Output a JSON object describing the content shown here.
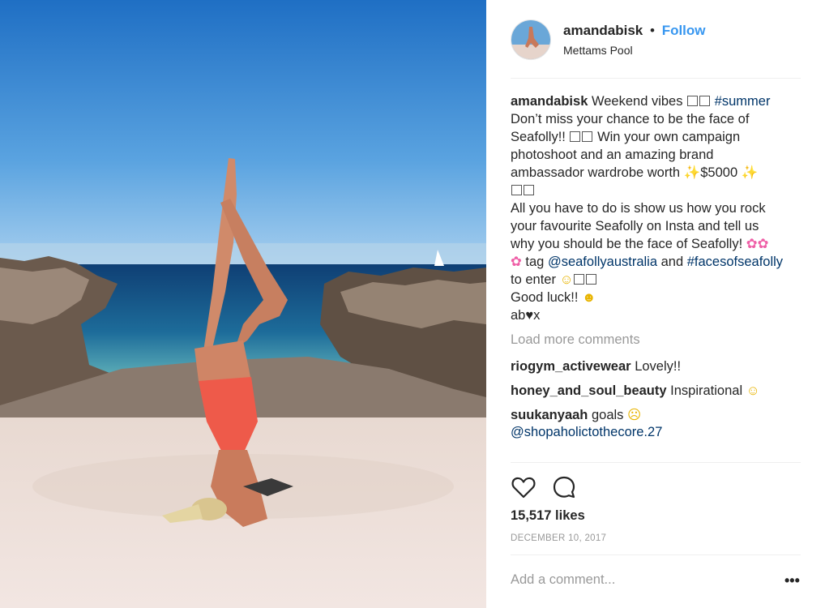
{
  "post": {
    "username": "amandabisk",
    "follow_label": "Follow",
    "bullet": "•",
    "location": "Mettams Pool"
  },
  "caption": {
    "username": "amandabisk",
    "line1_text": "Weekend vibes",
    "line1_tag": "#summer",
    "line2": "Don’t miss your chance to be the face of",
    "line3": "Seafolly!!",
    "line3b": "Win your own campaign",
    "line4": "photoshoot and an amazing brand",
    "line5a": "ambassador wardrobe worth",
    "line5b": "$5000",
    "line7": "All you have to do is show us how you rock",
    "line8": "your favourite Seafolly on Insta and tell us",
    "line9": "why you should be the face of Seafolly!",
    "line10a": "tag",
    "line10_mention": "@seafollyaustralia",
    "line10b": "and",
    "line10_tag": "#facesofseafolly",
    "line11": "to enter",
    "line12": "Good luck!!",
    "line13": "ab♥x"
  },
  "load_more_label": "Load more comments",
  "comments": [
    {
      "user": "riogym_activewear",
      "text": "Lovely!!"
    },
    {
      "user": "honey_and_soul_beauty",
      "text": "Inspirational"
    },
    {
      "user": "suukanyaah",
      "text": "goals",
      "mention": "@shopaholictothecore.27"
    }
  ],
  "likes": "15,517 likes",
  "date": "DECEMBER 10, 2017",
  "add_comment_placeholder": "Add a comment...",
  "more_options": "•••",
  "icons": [
    "heart-icon",
    "comment-icon",
    "more-options-icon"
  ],
  "colors": {
    "follow": "#3897f0",
    "hashtag": "#003569",
    "muted": "#999999"
  }
}
